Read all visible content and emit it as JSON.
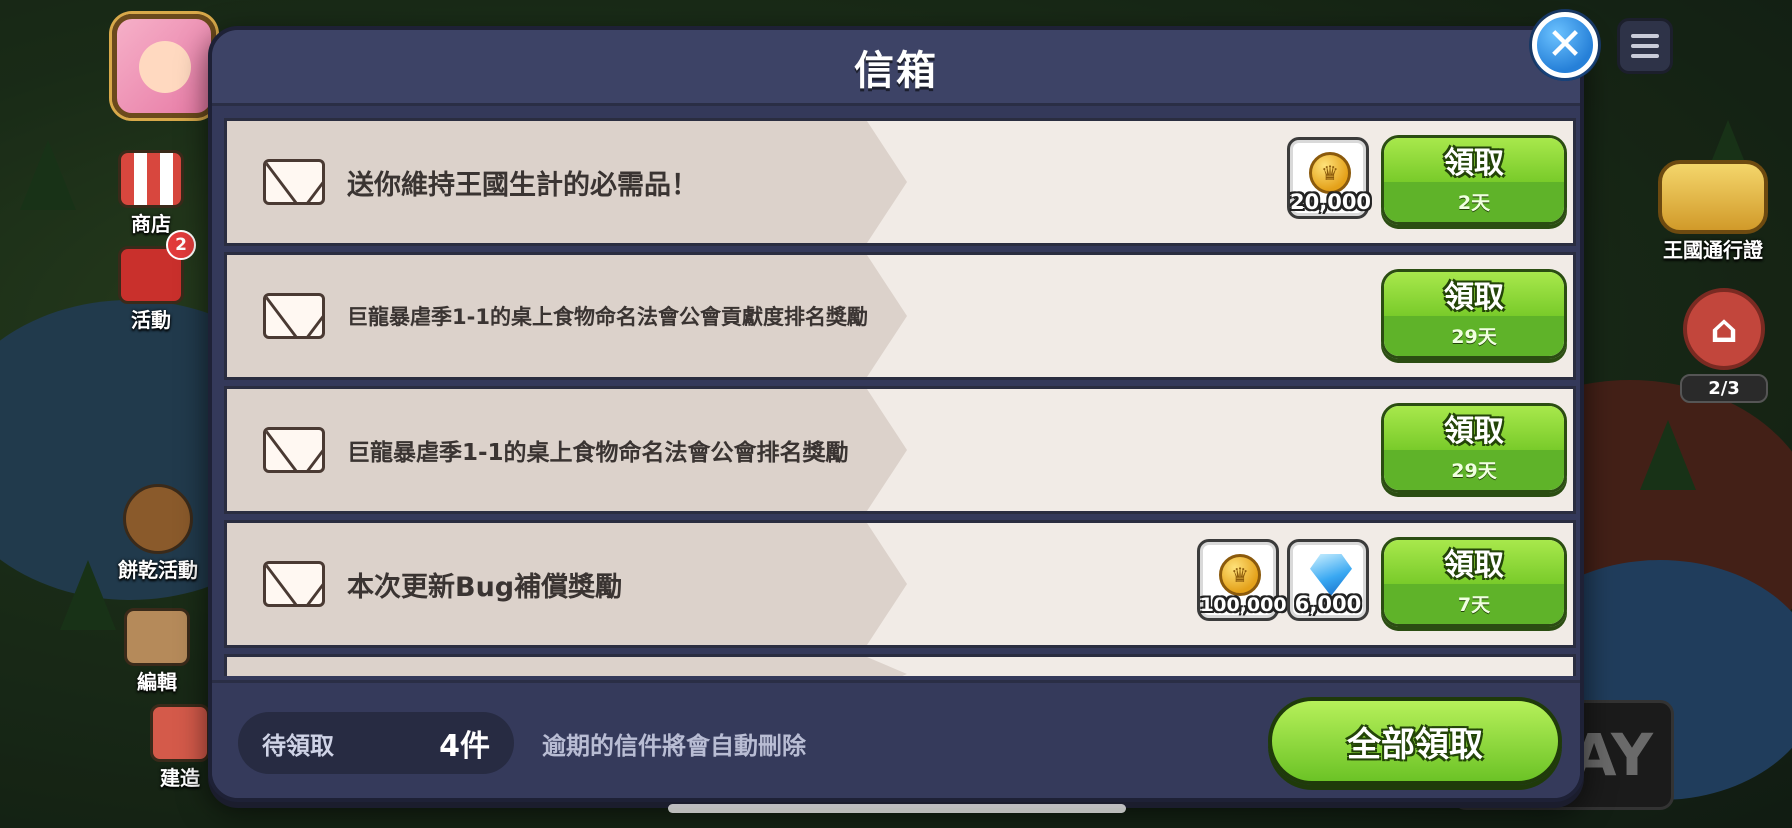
{
  "modal": {
    "title": "信箱",
    "close_icon": "✕"
  },
  "side_menu": {
    "shop_label": "商店",
    "event_label": "活動",
    "event_badge": "2",
    "cookie_event_label": "餅乾活動",
    "edit_label": "編輯",
    "build_label": "建造"
  },
  "right_menu": {
    "pass_label": "王國通行證",
    "house_count": "2/3",
    "play_text": "AY"
  },
  "mails": [
    {
      "title": "送你維持王國生計的必需品！",
      "rewards": [
        {
          "icon": "coin-icon",
          "amount": "20,000"
        }
      ],
      "claim_label": "領取",
      "days_left": "2天"
    },
    {
      "title": "巨龍暴虐季1-1的桌上食物命名法會公會貢獻度排名獎勵",
      "rewards": [],
      "claim_label": "領取",
      "days_left": "29天"
    },
    {
      "title": "巨龍暴虐季1-1的桌上食物命名法會公會排名獎勵",
      "rewards": [],
      "claim_label": "領取",
      "days_left": "29天"
    },
    {
      "title": "本次更新Bug補償獎勵",
      "rewards": [
        {
          "icon": "coin-icon",
          "amount": "100,000"
        },
        {
          "icon": "gem-icon",
          "amount": "6,000"
        }
      ],
      "claim_label": "領取",
      "days_left": "7天"
    }
  ],
  "footer": {
    "pending_label": "待領取",
    "pending_count": "4件",
    "expire_note": "逾期的信件將會自動刪除",
    "claim_all_label": "全部領取"
  },
  "colors": {
    "panel": "#34395a",
    "row_bg": "#f1ebe6",
    "claim_green": "#79cb2a",
    "close_blue": "#2680d8"
  }
}
